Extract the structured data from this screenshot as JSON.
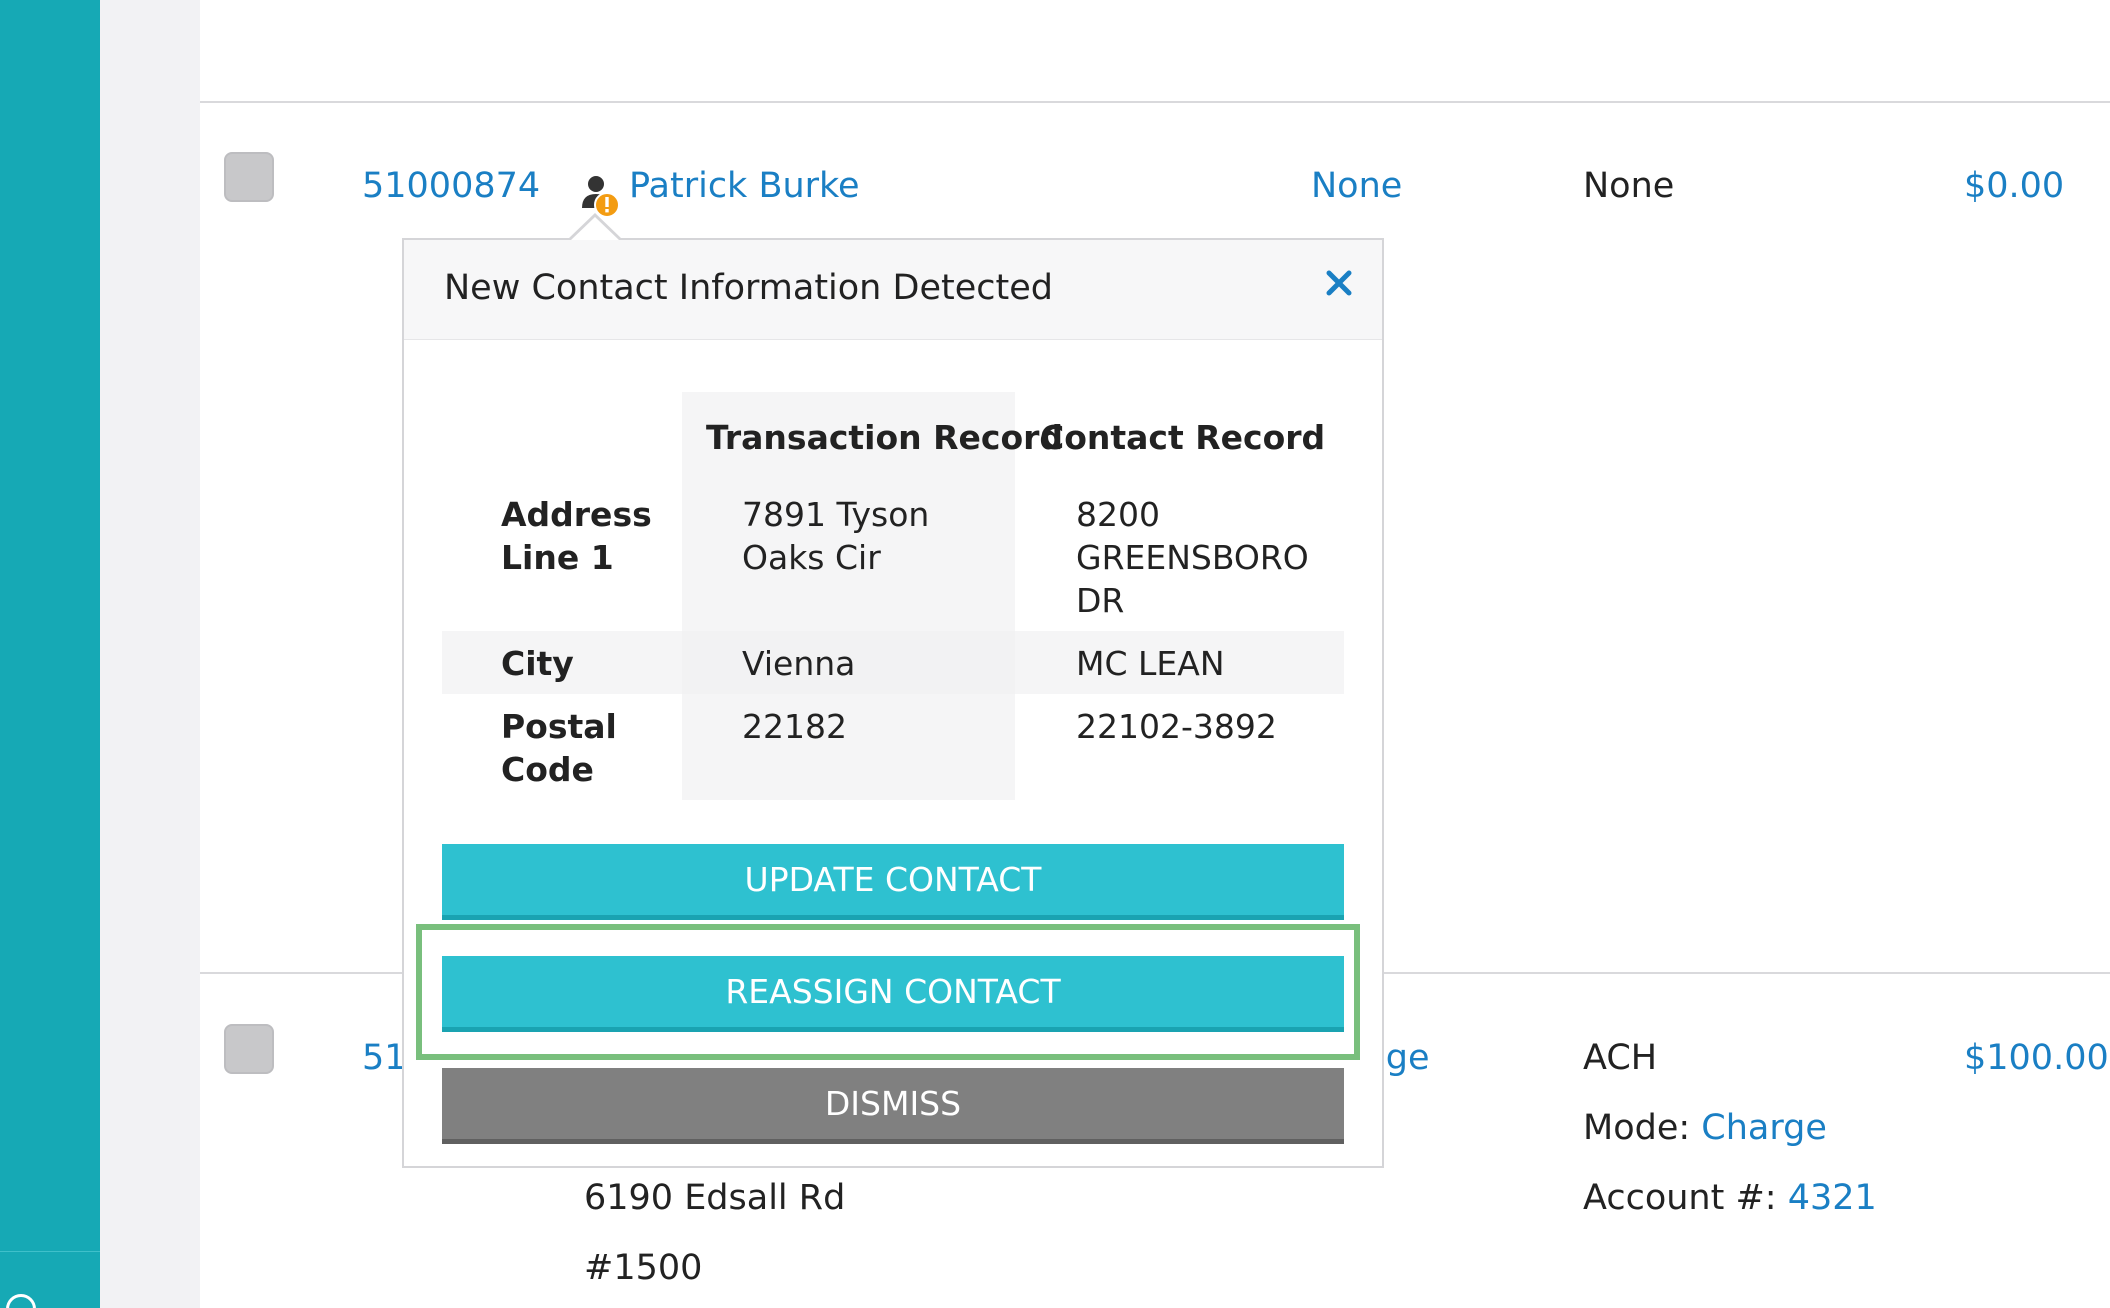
{
  "colors": {
    "rail": "#16a9b5",
    "link": "#1a7fc4",
    "button_primary": "#2ec1d0",
    "button_dismiss": "#808080",
    "highlight": "#79bf7d",
    "warning_badge": "#f39c12"
  },
  "rows": [
    {
      "id": "51000874",
      "name": "Patrick Burke",
      "col_link": "None",
      "col_text": "None",
      "amount": "$0.00"
    },
    {
      "id_partial": "51",
      "col_link_partial": "lge",
      "payment_type": "ACH",
      "mode_label": "Mode:",
      "mode_value": "Charge",
      "account_label": "Account #:",
      "account_value": "4321",
      "amount": "$100.00",
      "address_line1": "6190 Edsall Rd",
      "address_line2": "#1500"
    }
  ],
  "popover": {
    "title": "New Contact Information Detected",
    "close_icon": "close-icon",
    "columns": {
      "transaction": "Transaction Record",
      "contact": "Contact Record"
    },
    "fields": [
      {
        "label_lines": [
          "Address",
          "Line 1"
        ],
        "transaction_lines": [
          "7891 Tyson",
          "Oaks Cir"
        ],
        "contact_lines": [
          "8200",
          "GREENSBORO",
          "DR"
        ]
      },
      {
        "label_lines": [
          "City"
        ],
        "transaction_lines": [
          "Vienna"
        ],
        "contact_lines": [
          "MC LEAN"
        ]
      },
      {
        "label_lines": [
          "Postal",
          "Code"
        ],
        "transaction_lines": [
          "22182"
        ],
        "contact_lines": [
          "22102-3892"
        ]
      }
    ],
    "buttons": {
      "update": "UPDATE CONTACT",
      "reassign": "REASSIGN CONTACT",
      "dismiss": "DISMISS"
    }
  }
}
